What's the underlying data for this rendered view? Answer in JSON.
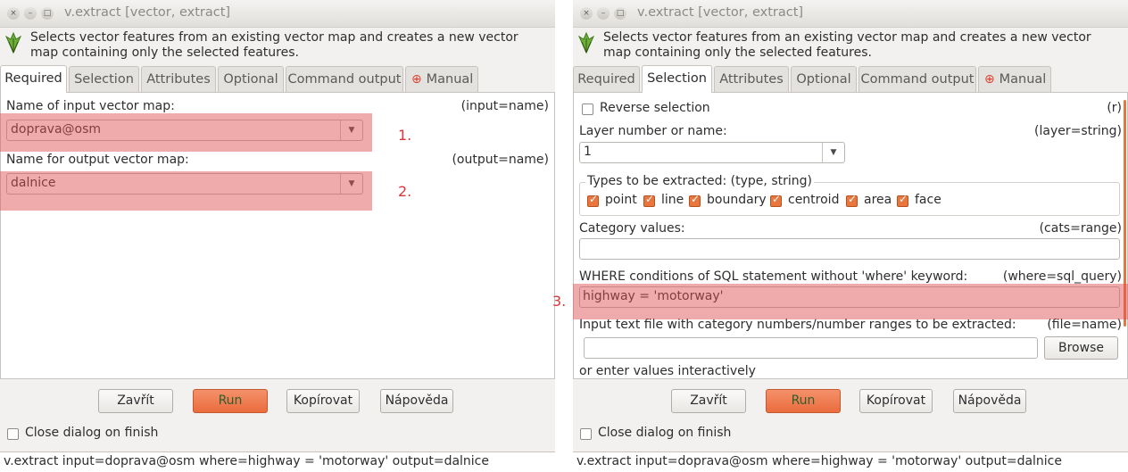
{
  "window_title": "v.extract [vector, extract]",
  "title_buttons": [
    "×",
    "–",
    "□"
  ],
  "description": "Selects vector features from an existing vector map and creates a new vector map containing only the selected features.",
  "tabs": [
    "Required",
    "Selection",
    "Attributes",
    "Optional",
    "Command output",
    "Manual"
  ],
  "left": {
    "active_tab": "Required",
    "input_label": "Name of input vector map:",
    "input_key": "(input=name)",
    "input_value": "doprava@osm",
    "output_label": "Name for output vector map:",
    "output_key": "(output=name)",
    "output_value": "dalnice",
    "annotation_1": "1.",
    "annotation_2": "2."
  },
  "right": {
    "active_tab": "Selection",
    "reverse_label": "Reverse selection",
    "reverse_key": "(r)",
    "reverse_checked": false,
    "layer_label": "Layer number or name:",
    "layer_key": "(layer=string)",
    "layer_value": "1",
    "types_label": "Types to be extracted: (type, string)",
    "types": [
      {
        "label": "point",
        "checked": true
      },
      {
        "label": "line",
        "checked": true
      },
      {
        "label": "boundary",
        "checked": true
      },
      {
        "label": "centroid",
        "checked": true
      },
      {
        "label": "area",
        "checked": true
      },
      {
        "label": "face",
        "checked": true
      }
    ],
    "cats_label": "Category values:",
    "cats_key": "(cats=range)",
    "cats_value": "",
    "where_label": "WHERE conditions of SQL statement without 'where' keyword:",
    "where_key": "(where=sql_query)",
    "where_value": "highway = 'motorway'",
    "annotation_3": "3.",
    "file_label": "Input text file with category numbers/number ranges to be extracted:",
    "file_key": "(file=name)",
    "file_value": "",
    "browse_label": "Browse",
    "interactive_label": "or enter values interactively"
  },
  "buttons": {
    "close": "Zavřít",
    "run": "Run",
    "copy": "Kopírovat",
    "help": "Nápověda"
  },
  "close_on_finish_label": "Close dialog on finish",
  "close_on_finish_checked": false,
  "command_line": "v.extract input=doprava@osm where=highway = 'motorway' output=dalnice",
  "colors": {
    "highlight": "#de5050",
    "annotation": "#d9383a",
    "run_button": "#ea6c3d",
    "checkbox_checked": "#e8763e"
  }
}
